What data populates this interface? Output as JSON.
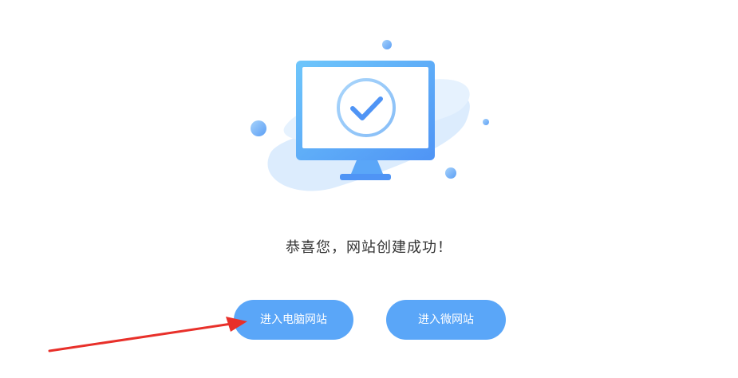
{
  "result": {
    "message": "恭喜您，网站创建成功！"
  },
  "actions": {
    "pc_label": "进入电脑网站",
    "mobile_label": "进入微网站"
  },
  "colors": {
    "button": "#5aa6f8",
    "monitor": "#5aa6f8",
    "blob": "#dcecfd",
    "arrow": "#e8302a",
    "text": "#333333"
  },
  "icons": {
    "illustration": "monitor-check-icon",
    "annotation": "red-arrow-icon"
  }
}
